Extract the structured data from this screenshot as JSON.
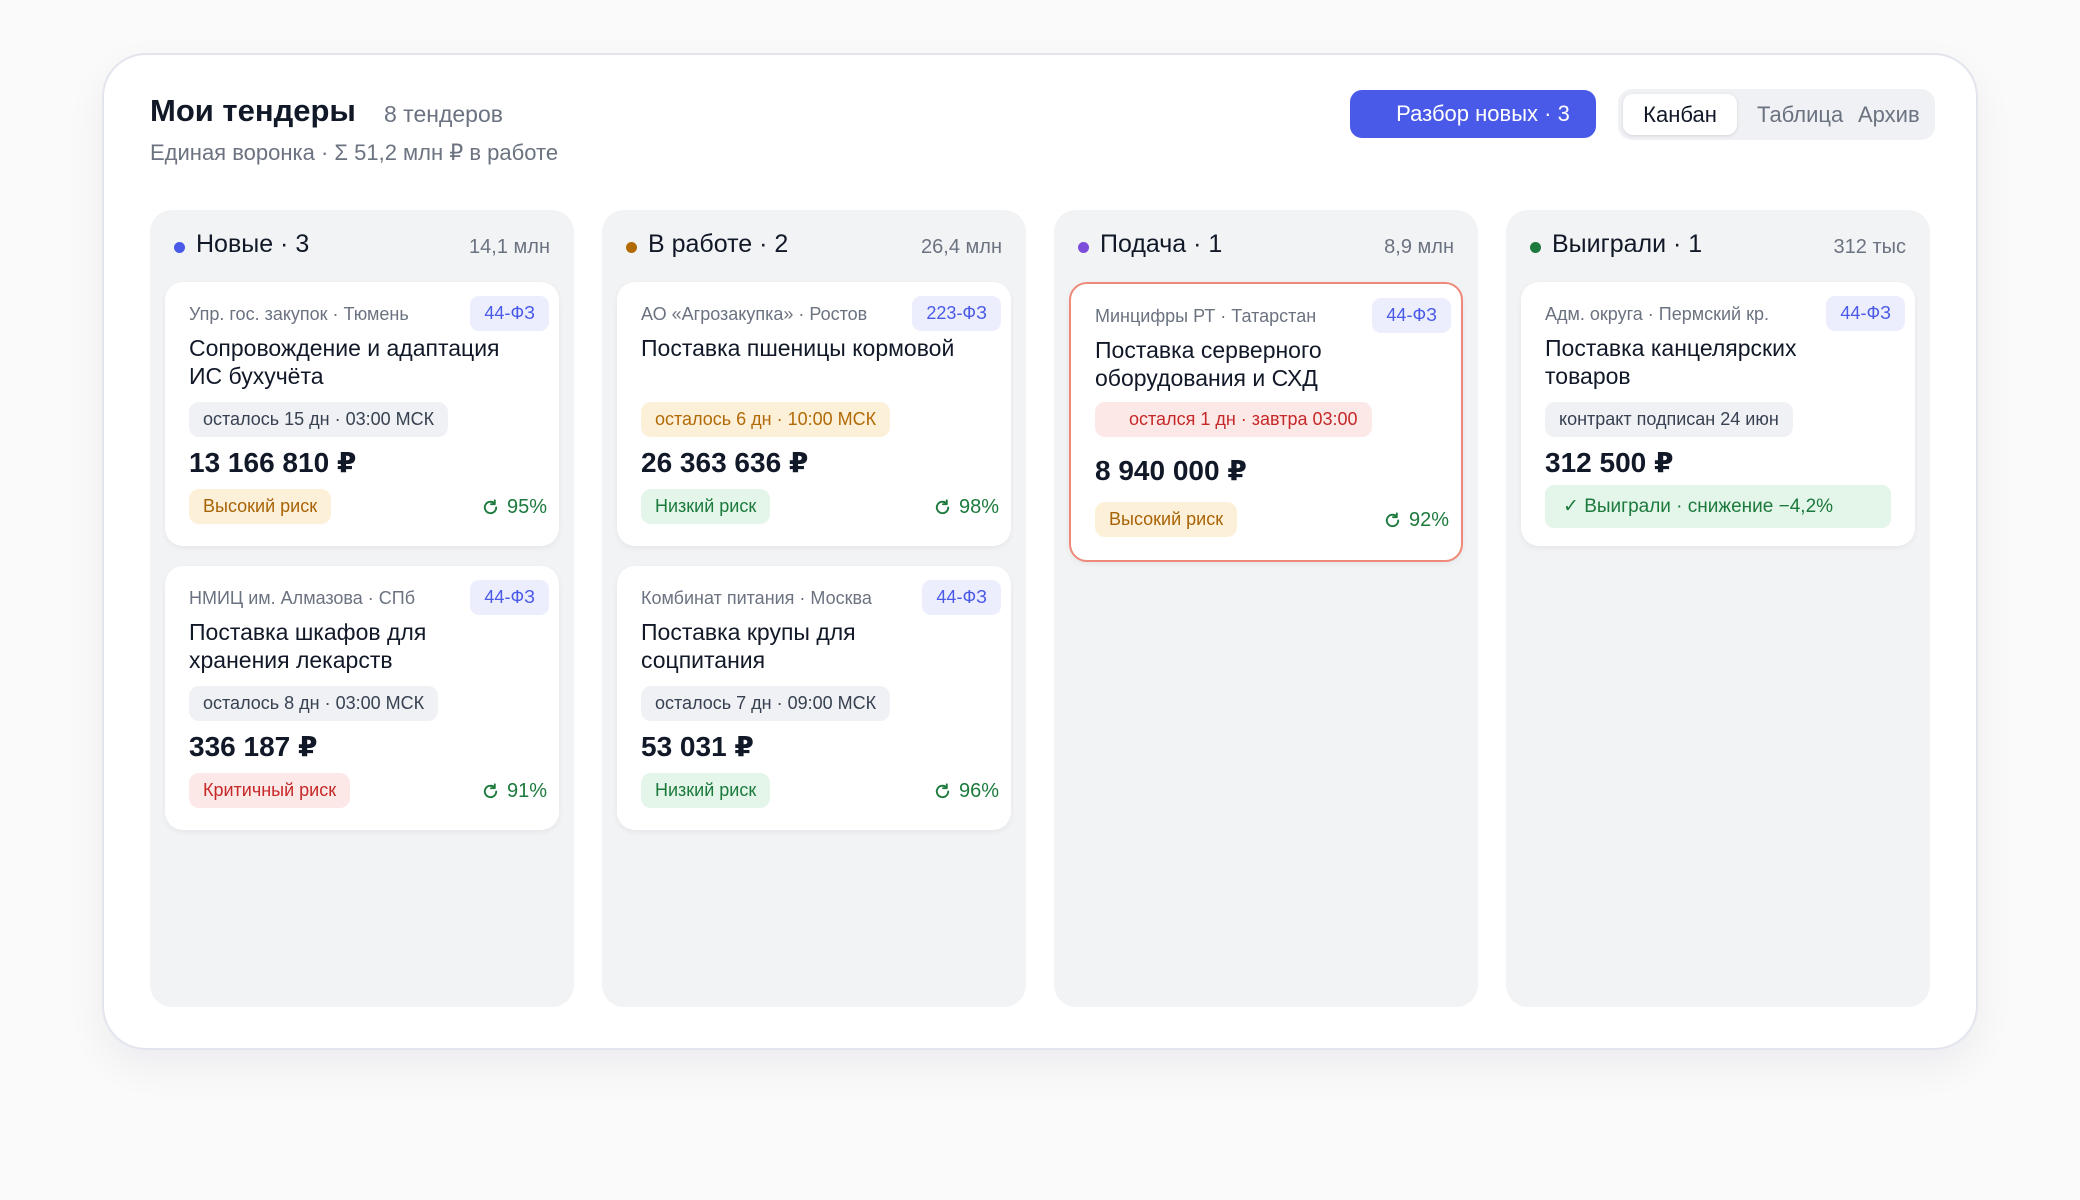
{
  "header": {
    "title": "Мои тендеры",
    "count": "8 тендеров",
    "subtitle": "Единая воронка · Σ 51,2 млн ₽ в работе",
    "primary_button": "Разбор новых · 3",
    "views": [
      "Канбан",
      "Таблица",
      "Архив"
    ],
    "active_view": "Канбан"
  },
  "colors": {
    "accent": "#4a5ae8",
    "new": "#4a5ae8",
    "in_work": "#b26a07",
    "submit": "#7c4ddb",
    "won": "#1c7a3c"
  },
  "columns": [
    {
      "title": "Новые · 3",
      "sum": "14,1 млн",
      "cards": [
        {
          "org": "Упр. гос. закупок · Тюмень",
          "law": "44-ФЗ",
          "title": "Сопровождение и адаптация ИС бухучёта",
          "deadline": "осталось 15 дн · 03:00 МСК",
          "price": "13 166 810 ₽",
          "risk": "Высокий риск",
          "score": "95%"
        },
        {
          "org": "НМИЦ им. Алмазова · СПб",
          "law": "44-ФЗ",
          "title": "Поставка шкафов для хранения лекарств",
          "deadline": "осталось 8 дн · 03:00 МСК",
          "price": "336 187 ₽",
          "risk": "Критичный риск",
          "score": "91%"
        }
      ]
    },
    {
      "title": "В работе · 2",
      "sum": "26,4 млн",
      "cards": [
        {
          "org": "АО «Агрозакупка» · Ростов",
          "law": "223-ФЗ",
          "title": "Поставка пшеницы кормовой",
          "deadline": "осталось 6 дн · 10:00 МСК",
          "price": "26 363 636 ₽",
          "risk": "Низкий риск",
          "score": "98%"
        },
        {
          "org": "Комбинат питания · Москва",
          "law": "44-ФЗ",
          "title": "Поставка крупы для соцпитания",
          "deadline": "осталось 7 дн · 09:00 МСК",
          "price": "53 031 ₽",
          "risk": "Низкий риск",
          "score": "96%"
        }
      ]
    },
    {
      "title": "Подача · 1",
      "sum": "8,9 млн",
      "cards": [
        {
          "org": "Минцифры РТ · Татарстан",
          "law": "44-ФЗ",
          "title": "Поставка серверного оборудования и СХД",
          "deadline": "остался 1 дн · завтра 03:00",
          "price": "8 940 000 ₽",
          "risk": "Высокий риск",
          "score": "92%"
        }
      ]
    },
    {
      "title": "Выиграли · 1",
      "sum": "312 тыс",
      "cards": [
        {
          "org": "Адм. округа · Пермский кр.",
          "law": "44-ФЗ",
          "title": "Поставка канцелярских товаров",
          "deadline": "контракт подписан 24 июн",
          "price": "312 500 ₽",
          "result": "✓ Выиграли · снижение −4,2%"
        }
      ]
    }
  ]
}
